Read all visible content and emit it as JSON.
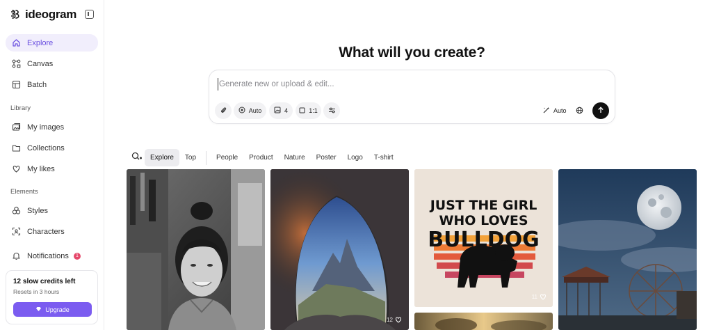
{
  "app": {
    "name": "ideogram"
  },
  "sidebar": {
    "items": [
      {
        "label": "Explore",
        "icon": "home-icon",
        "active": true
      },
      {
        "label": "Canvas",
        "icon": "canvas-icon"
      },
      {
        "label": "Batch",
        "icon": "batch-icon"
      }
    ],
    "library_label": "Library",
    "library_items": [
      {
        "label": "My images",
        "icon": "images-icon"
      },
      {
        "label": "Collections",
        "icon": "folder-icon"
      },
      {
        "label": "My likes",
        "icon": "heart-icon"
      }
    ],
    "elements_label": "Elements",
    "elements_items": [
      {
        "label": "Styles",
        "icon": "styles-icon"
      },
      {
        "label": "Characters",
        "icon": "characters-icon"
      }
    ],
    "notifications": {
      "label": "Notifications",
      "count": "1"
    },
    "credits": {
      "title": "12 slow credits left",
      "subtitle": "Resets in 3 hours",
      "upgrade_label": "Upgrade"
    }
  },
  "main": {
    "headline": "What will you create?",
    "prompt": {
      "placeholder": "Generate new or upload & edit...",
      "value": "",
      "model_label": "Auto",
      "count_label": "4",
      "aspect_label": "1:1",
      "magic_prompt_label": "Auto"
    },
    "filters": {
      "tabs": [
        "Explore",
        "Top"
      ],
      "active": "Explore",
      "categories": [
        "People",
        "Product",
        "Nature",
        "Poster",
        "Logo",
        "T-shirt"
      ]
    },
    "gallery": {
      "poster_text": [
        "JUST THE GIRL",
        "WHO LOVES",
        "BULLDOG"
      ],
      "likes": [
        "11",
        "12"
      ]
    }
  },
  "colors": {
    "accent": "#7b5cf0",
    "active_nav_bg": "#f1eefc",
    "active_nav_text": "#6a4fe0",
    "badge": "#e5486a"
  }
}
